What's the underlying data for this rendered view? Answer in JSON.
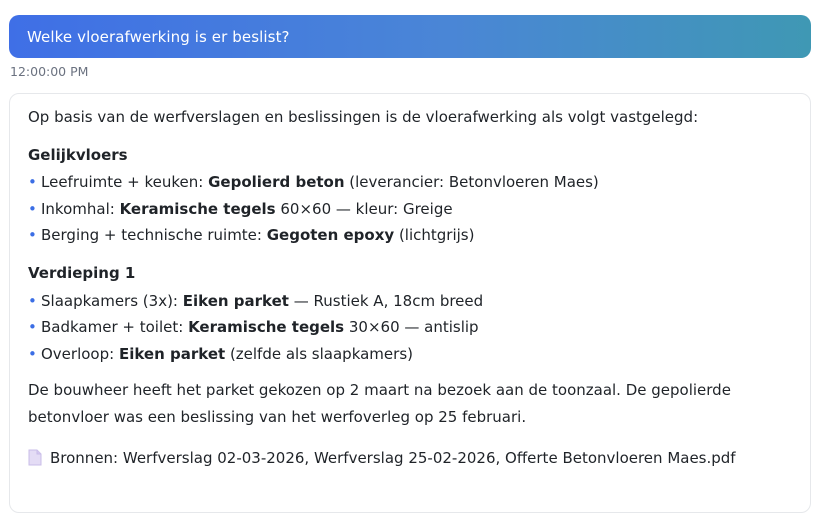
{
  "user_message": {
    "text": "Welke vloerafwerking is er beslist?",
    "timestamp": "12:00:00 PM"
  },
  "answer": {
    "intro": "Op basis van de werfverslagen en beslissingen is de vloerafwerking als volgt vastgelegd:",
    "sections": [
      {
        "title": "Gelijkvloers",
        "items": [
          {
            "prefix": "Leefruimte + keuken: ",
            "bold": "Gepolierd beton",
            "suffix": " (leverancier: Betonvloeren Maes)"
          },
          {
            "prefix": "Inkomhal: ",
            "bold": "Keramische tegels",
            "suffix": " 60×60 — kleur: Greige"
          },
          {
            "prefix": "Berging + technische ruimte: ",
            "bold": "Gegoten epoxy",
            "suffix": " (lichtgrijs)"
          }
        ]
      },
      {
        "title": "Verdieping 1",
        "items": [
          {
            "prefix": "Slaapkamers (3x): ",
            "bold": "Eiken parket",
            "suffix": " — Rustiek A, 18cm breed"
          },
          {
            "prefix": "Badkamer + toilet: ",
            "bold": "Keramische tegels",
            "suffix": " 30×60 — antislip"
          },
          {
            "prefix": "Overloop: ",
            "bold": "Eiken parket",
            "suffix": " (zelfde als slaapkamers)"
          }
        ]
      }
    ],
    "summary": "De bouwheer heeft het parket gekozen op 2 maart na bezoek aan de toonzaal. De gepolierde betonvloer was een beslissing van het werfoverleg op 25 februari.",
    "sources": "Bronnen: Werfverslag 02-03-2026, Werfverslag 25-02-2026, Offerte Betonvloeren Maes.pdf",
    "sources_icon": "document-icon",
    "bullet_color": "#3b6ee5"
  }
}
